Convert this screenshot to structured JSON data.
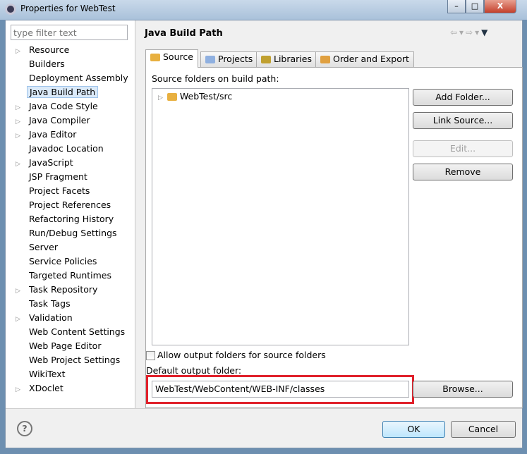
{
  "window": {
    "title": "Properties for WebTest",
    "minimize": "–",
    "maximize": "□",
    "close": "X"
  },
  "filter": {
    "placeholder": "type filter text"
  },
  "sidebar": {
    "items": [
      {
        "label": "Resource",
        "expandable": true
      },
      {
        "label": "Builders"
      },
      {
        "label": "Deployment Assembly"
      },
      {
        "label": "Java Build Path",
        "selected": true
      },
      {
        "label": "Java Code Style",
        "expandable": true
      },
      {
        "label": "Java Compiler",
        "expandable": true
      },
      {
        "label": "Java Editor",
        "expandable": true
      },
      {
        "label": "Javadoc Location"
      },
      {
        "label": "JavaScript",
        "expandable": true
      },
      {
        "label": "JSP Fragment"
      },
      {
        "label": "Project Facets"
      },
      {
        "label": "Project References"
      },
      {
        "label": "Refactoring History"
      },
      {
        "label": "Run/Debug Settings"
      },
      {
        "label": "Server"
      },
      {
        "label": "Service Policies"
      },
      {
        "label": "Targeted Runtimes"
      },
      {
        "label": "Task Repository",
        "expandable": true
      },
      {
        "label": "Task Tags"
      },
      {
        "label": "Validation",
        "expandable": true
      },
      {
        "label": "Web Content Settings"
      },
      {
        "label": "Web Page Editor"
      },
      {
        "label": "Web Project Settings"
      },
      {
        "label": "WikiText"
      },
      {
        "label": "XDoclet",
        "expandable": true
      }
    ]
  },
  "main": {
    "title": "Java Build Path",
    "tabs": [
      {
        "label": "Source",
        "active": true
      },
      {
        "label": "Projects"
      },
      {
        "label": "Libraries"
      },
      {
        "label": "Order and Export"
      }
    ],
    "source_label": "Source folders on build path:",
    "source_folders": [
      "WebTest/src"
    ],
    "buttons": {
      "add_folder": "Add Folder...",
      "link_source": "Link Source...",
      "edit": "Edit...",
      "remove": "Remove",
      "browse": "Browse..."
    },
    "allow_output_label": "Allow output folders for source folders",
    "allow_output_checked": false,
    "output_label": "Default output folder:",
    "output_value": "WebTest/WebContent/WEB-INF/classes",
    "highlight_color": "#e0202a"
  },
  "footer": {
    "ok": "OK",
    "cancel": "Cancel",
    "help": "?"
  }
}
